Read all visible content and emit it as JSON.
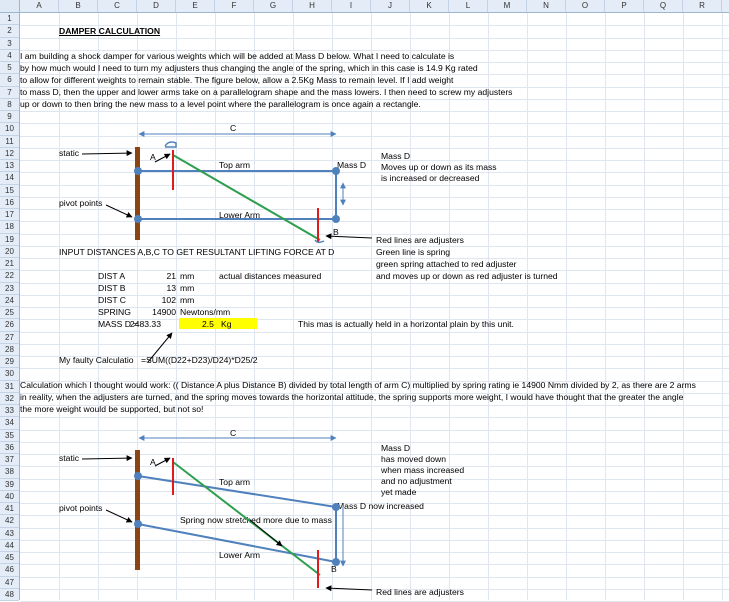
{
  "columns": [
    "A",
    "B",
    "C",
    "D",
    "E",
    "F",
    "G",
    "H",
    "I",
    "J",
    "K",
    "L",
    "M",
    "N",
    "O",
    "P",
    "Q",
    "R"
  ],
  "rows": [
    "1",
    "2",
    "3",
    "4",
    "5",
    "6",
    "7",
    "8",
    "9",
    "10",
    "11",
    "12",
    "13",
    "14",
    "15",
    "16",
    "17",
    "18",
    "19",
    "20",
    "21",
    "22",
    "23",
    "24",
    "25",
    "26",
    "27",
    "28",
    "29",
    "30",
    "31",
    "32",
    "33",
    "34",
    "35",
    "36",
    "37",
    "38",
    "39",
    "40",
    "41",
    "42",
    "43",
    "44",
    "45",
    "46",
    "47",
    "48"
  ],
  "title": "DAMPER CALCULATION",
  "intro": [
    "I am building a shock damper for various weights which will be added at Mass D below.  What I need to calculate is",
    "by how much would I need to turn my adjusters thus changing the angle of the spring, which in this case is 14.9 Kg rated",
    "to allow for different weights to remain stable.  The figure below, allow a 2.5Kg Mass to remain level.  If I add weight",
    "to mass D, then the upper and lower arms take on a parallelogram shape and the mass lowers.  I then need to screw my adjusters",
    "up or down to then bring the new mass to a level point where the parallelogram is once again a rectangle."
  ],
  "diagram1": {
    "c_label": "C",
    "static": "static",
    "a_label": "A",
    "top_arm": "Top arm",
    "mass_d": "Mass D",
    "mass_d_note": [
      "Mass D",
      "Moves up or down as its mass",
      "is increased or decreased"
    ],
    "pivot_points": "pivot points",
    "lower_arm": "Lower Arm",
    "b_label": "B",
    "notes": [
      "Red lines are adjusters",
      "Green line is spring",
      "green spring attached to red adjuster",
      "and moves up or down as red adjuster is turned"
    ]
  },
  "input_heading": "INPUT DISTANCES A,B,C TO GET RESULTANT LIFTING FORCE AT D",
  "inputs": [
    {
      "label": "DIST A",
      "value": "21",
      "unit": "mm",
      "note": "actual distances measured"
    },
    {
      "label": "DIST B",
      "value": "13",
      "unit": "mm",
      "note": ""
    },
    {
      "label": "DIST C",
      "value": "102",
      "unit": "mm",
      "note": ""
    },
    {
      "label": "SPRING",
      "value": "14900",
      "unit": "Newtons/mm",
      "note": ""
    }
  ],
  "mass_row": {
    "label": "MASS D =",
    "value": "2483.33",
    "kg": "2.5",
    "kg_unit": "Kg",
    "note": "This mas is actually held in a horizontal plain by this unit."
  },
  "faulty_label": "My faulty Calculatio",
  "faulty_formula": "=SUM((D22+D23)/D24)*D25/2",
  "explain": [
    "Calculation which I thought would work: (( Distance A plus Distance B) divided by total length of arm C) multiplied by spring rating ie 14900 Nmm divided by 2, as there are 2 arms",
    "in reality, when the adjusters are turned, and the spring moves towards the horizontal attitude, the spring supports more weight, I would have thought that the greater the angle",
    "the more weight would be supported, but not so!"
  ],
  "diagram2": {
    "c_label": "C",
    "static": "static",
    "a_label": "A",
    "top_arm": "Top arm",
    "mass_d": "Mass D now increased",
    "mass_d_note": [
      "Mass D",
      "has moved down",
      "when mass increased",
      "and no adjustment",
      "yet made"
    ],
    "pivot_points": "pivot points",
    "spring_note": "Spring now stretched more due to mass",
    "lower_arm": "Lower Arm",
    "b_label": "B",
    "notes": [
      "Red lines are adjusters"
    ]
  },
  "colors": {
    "header_bg": "#e4ecf7",
    "highlight": "#ffff00",
    "arm": "#4f81bd",
    "post": "#8b4513",
    "spring": "#2e9e4f",
    "adjuster": "#e11b1b"
  }
}
